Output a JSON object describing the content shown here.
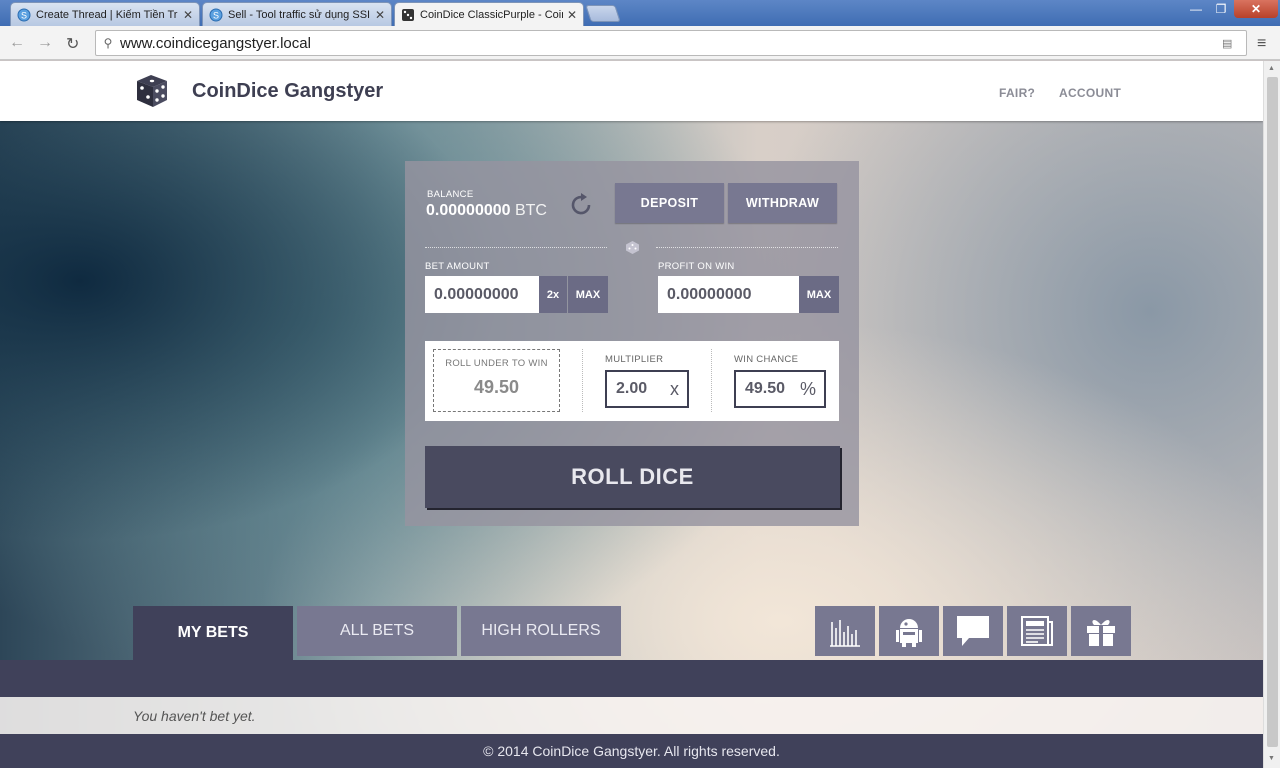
{
  "browser": {
    "tabs": [
      {
        "title": "Create Thread | Kiếm Tiền Tr",
        "icon": "site-s-icon"
      },
      {
        "title": "Sell - Tool traffic sử dụng SSI",
        "icon": "site-s-icon"
      },
      {
        "title": "CoinDice ClassicPurple - Coin",
        "icon": "dice-icon"
      }
    ],
    "url": "www.coindicegangstyer.local",
    "window_controls": {
      "minimize": "—",
      "restore": "❐",
      "close": "✕"
    }
  },
  "header": {
    "brand": "CoinDice Gangstyer",
    "nav": [
      "FAIR?",
      "ACCOUNT"
    ]
  },
  "panel": {
    "balance_label": "BALANCE",
    "balance_value": "0.00000000",
    "balance_currency": "BTC",
    "deposit": "DEPOSIT",
    "withdraw": "WITHDRAW",
    "bet_amount_label": "BET AMOUNT",
    "bet_amount": "0.00000000",
    "double": "2x",
    "max": "MAX",
    "profit_label": "PROFIT ON WIN",
    "profit": "0.00000000",
    "roll_under_label": "ROLL UNDER TO WIN",
    "roll_under": "49.50",
    "multiplier_label": "MULTIPLIER",
    "multiplier": "2.00",
    "multiplier_suffix": "x",
    "win_chance_label": "WIN CHANCE",
    "win_chance": "49.50",
    "win_chance_suffix": "%",
    "roll_button": "ROLL DICE"
  },
  "bets": {
    "tabs": [
      "MY BETS",
      "ALL BETS",
      "HIGH ROLLERS"
    ],
    "active_tab": "MY BETS",
    "icon_buttons": [
      "chart-icon",
      "robot-icon",
      "chat-icon",
      "news-icon",
      "gift-icon"
    ],
    "empty_message": "You haven't bet yet."
  },
  "footer": "© 2014 CoinDice Gangstyer. All rights reserved.",
  "colors": {
    "dark": "#40415a",
    "button": "#787891",
    "accent_text": "#3e3f52"
  }
}
